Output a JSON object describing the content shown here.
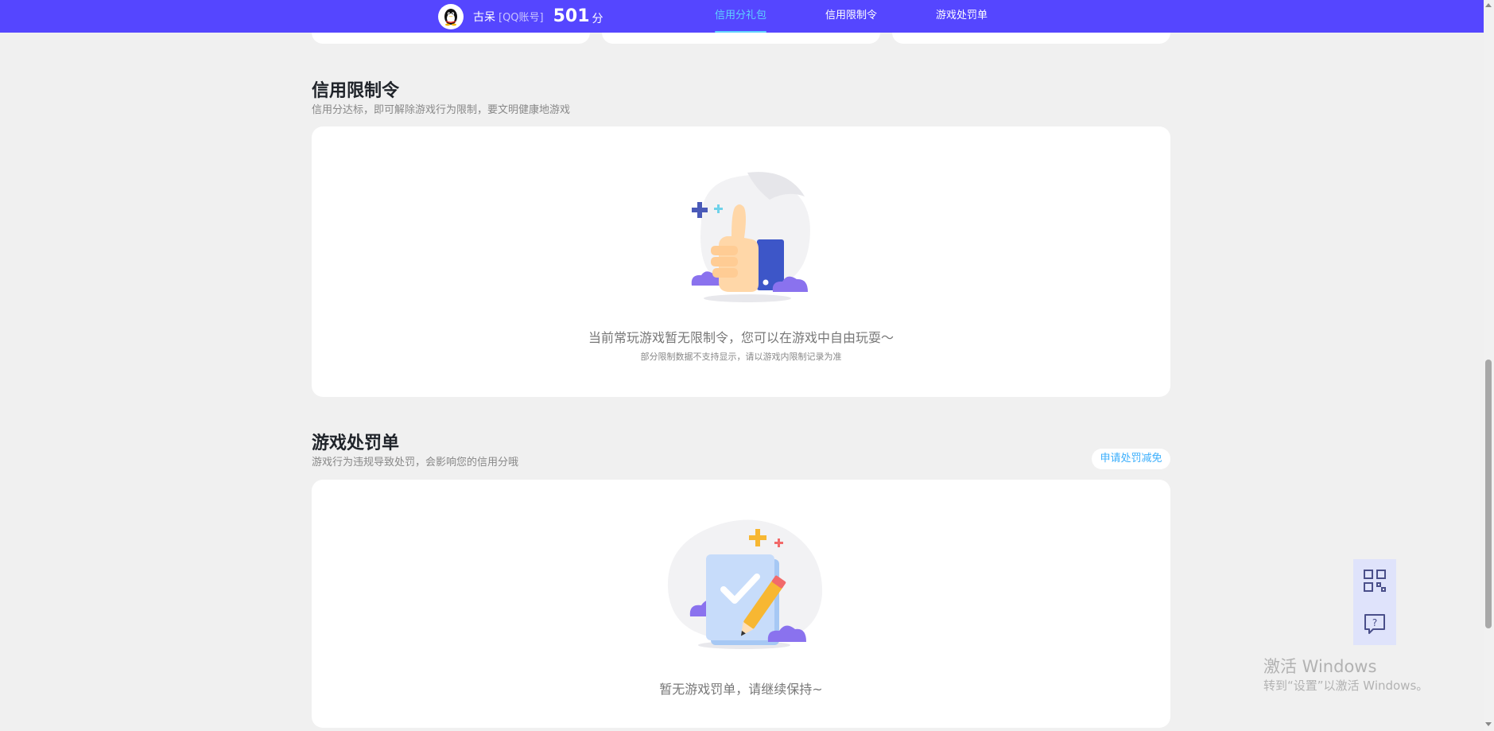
{
  "header": {
    "nickname": "古呆",
    "account_tag": "[QQ账号]",
    "score": "501",
    "score_unit": "分",
    "tabs": [
      {
        "label": "信用分礼包",
        "active": true
      },
      {
        "label": "信用限制令",
        "active": false
      },
      {
        "label": "游戏处罚单",
        "active": false
      }
    ]
  },
  "restriction": {
    "title": "信用限制令",
    "subtitle": "信用分达标，即可解除游戏行为限制，要文明健康地游戏",
    "empty_text": "当前常玩游戏暂无限制令，您可以在游戏中自由玩耍～",
    "empty_note": "部分限制数据不支持显示，请以游戏内限制记录为准",
    "icon": "thumbs-up-illustration"
  },
  "penalty": {
    "title": "游戏处罚单",
    "subtitle": "游戏行为违规导致处罚，会影响您的信用分哦",
    "appeal_label": "申请处罚减免",
    "empty_text": "暂无游戏罚单，请继续保持~",
    "icon": "clipboard-check-illustration"
  },
  "float_buttons": [
    {
      "icon": "qrcode-icon"
    },
    {
      "icon": "help-chat-icon"
    }
  ],
  "watermark": {
    "line1": "激活 Windows",
    "line2": "转到“设置”以激活 Windows。"
  },
  "colors": {
    "header_bg": "#5546ff",
    "tab_active": "#5fd2ff",
    "appeal_text": "#3aaefc",
    "page_bg": "#f0f0f0"
  }
}
